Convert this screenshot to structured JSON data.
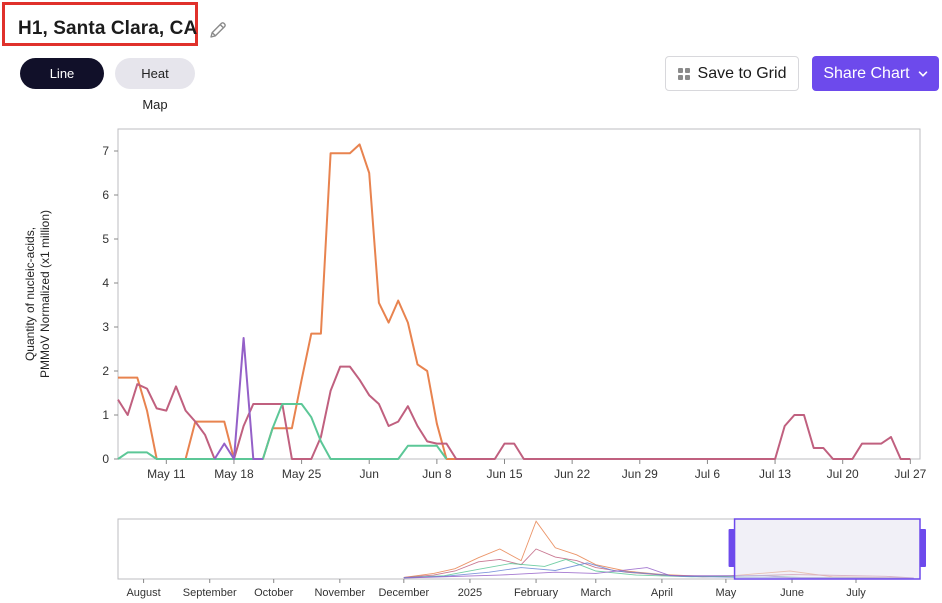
{
  "header": {
    "title": "H1, Santa Clara, CA",
    "tabs": [
      {
        "label": "Line Chart",
        "active": true
      },
      {
        "label": "Heat Map",
        "active": false
      }
    ],
    "save_label": "Save to Grid",
    "share_label": "Share Chart"
  },
  "colors": {
    "accent": "#6d4aec",
    "highlight_box": "#e0312b",
    "series_orange": "#e8834f",
    "series_mauve": "#c0607f",
    "series_green": "#5cc797",
    "series_purple": "#9460c8"
  },
  "chart_data": {
    "type": "line",
    "title": "",
    "xlabel": "",
    "ylabel_lines": [
      "Quantity of nucleic-acids,",
      "PMMoV Normalized (x1 million)"
    ],
    "x_start": "2025-05-06",
    "x_end": "2025-07-28",
    "ylim": [
      0,
      7.5
    ],
    "yticks": [
      0,
      1,
      2,
      3,
      4,
      5,
      6,
      7
    ],
    "xticks": [
      {
        "label": "May 11",
        "date": "2025-05-11"
      },
      {
        "label": "May 18",
        "date": "2025-05-18"
      },
      {
        "label": "May 25",
        "date": "2025-05-25"
      },
      {
        "label": "Jun",
        "date": "2025-06-01"
      },
      {
        "label": "Jun 8",
        "date": "2025-06-08"
      },
      {
        "label": "Jun 15",
        "date": "2025-06-15"
      },
      {
        "label": "Jun 22",
        "date": "2025-06-22"
      },
      {
        "label": "Jun 29",
        "date": "2025-06-29"
      },
      {
        "label": "Jul 6",
        "date": "2025-07-06"
      },
      {
        "label": "Jul 13",
        "date": "2025-07-13"
      },
      {
        "label": "Jul 20",
        "date": "2025-07-20"
      },
      {
        "label": "Jul 27",
        "date": "2025-07-27"
      }
    ],
    "grid": false,
    "series": [
      {
        "color": "#e8834f",
        "points": [
          [
            "2025-05-06",
            1.85
          ],
          [
            "2025-05-08",
            1.85
          ],
          [
            "2025-05-09",
            1.1
          ],
          [
            "2025-05-10",
            0
          ],
          [
            "2025-05-12",
            0
          ],
          [
            "2025-05-13",
            0
          ],
          [
            "2025-05-14",
            0.85
          ],
          [
            "2025-05-15",
            0.85
          ],
          [
            "2025-05-16",
            0.85
          ],
          [
            "2025-05-17",
            0.85
          ],
          [
            "2025-05-18",
            0
          ],
          [
            "2025-05-20",
            0
          ],
          [
            "2025-05-21",
            0
          ],
          [
            "2025-05-22",
            0.7
          ],
          [
            "2025-05-23",
            0.7
          ],
          [
            "2025-05-24",
            0.7
          ],
          [
            "2025-05-25",
            1.8
          ],
          [
            "2025-05-26",
            2.85
          ],
          [
            "2025-05-27",
            2.85
          ],
          [
            "2025-05-28",
            6.95
          ],
          [
            "2025-05-29",
            6.95
          ],
          [
            "2025-05-30",
            6.95
          ],
          [
            "2025-05-31",
            7.15
          ],
          [
            "2025-06-01",
            6.5
          ],
          [
            "2025-06-02",
            3.55
          ],
          [
            "2025-06-03",
            3.1
          ],
          [
            "2025-06-04",
            3.6
          ],
          [
            "2025-06-05",
            3.1
          ],
          [
            "2025-06-06",
            2.15
          ],
          [
            "2025-06-07",
            2.0
          ],
          [
            "2025-06-08",
            0.8
          ],
          [
            "2025-06-09",
            0
          ],
          [
            "2025-06-10",
            0
          ]
        ]
      },
      {
        "color": "#c0607f",
        "points": [
          [
            "2025-05-06",
            1.35
          ],
          [
            "2025-05-07",
            1.0
          ],
          [
            "2025-05-08",
            1.7
          ],
          [
            "2025-05-09",
            1.6
          ],
          [
            "2025-05-10",
            1.15
          ],
          [
            "2025-05-11",
            1.1
          ],
          [
            "2025-05-12",
            1.65
          ],
          [
            "2025-05-13",
            1.1
          ],
          [
            "2025-05-14",
            0.85
          ],
          [
            "2025-05-15",
            0.55
          ],
          [
            "2025-05-16",
            0
          ],
          [
            "2025-05-18",
            0
          ],
          [
            "2025-05-19",
            0.75
          ],
          [
            "2025-05-20",
            1.25
          ],
          [
            "2025-05-21",
            1.25
          ],
          [
            "2025-05-22",
            1.25
          ],
          [
            "2025-05-23",
            1.25
          ],
          [
            "2025-05-24",
            0
          ],
          [
            "2025-05-25",
            0
          ],
          [
            "2025-05-26",
            0
          ],
          [
            "2025-05-27",
            0.5
          ],
          [
            "2025-05-28",
            1.55
          ],
          [
            "2025-05-29",
            2.1
          ],
          [
            "2025-05-30",
            2.1
          ],
          [
            "2025-05-31",
            1.8
          ],
          [
            "2025-06-01",
            1.45
          ],
          [
            "2025-06-02",
            1.25
          ],
          [
            "2025-06-03",
            0.75
          ],
          [
            "2025-06-04",
            0.85
          ],
          [
            "2025-06-05",
            1.2
          ],
          [
            "2025-06-06",
            0.75
          ],
          [
            "2025-06-07",
            0.4
          ],
          [
            "2025-06-08",
            0.35
          ],
          [
            "2025-06-09",
            0.35
          ],
          [
            "2025-06-10",
            0
          ],
          [
            "2025-06-14",
            0
          ],
          [
            "2025-06-15",
            0.35
          ],
          [
            "2025-06-16",
            0.35
          ],
          [
            "2025-06-17",
            0
          ],
          [
            "2025-07-12",
            0
          ],
          [
            "2025-07-13",
            0
          ],
          [
            "2025-07-14",
            0.75
          ],
          [
            "2025-07-15",
            1.0
          ],
          [
            "2025-07-16",
            1.0
          ],
          [
            "2025-07-17",
            0.25
          ],
          [
            "2025-07-18",
            0.25
          ],
          [
            "2025-07-19",
            0
          ],
          [
            "2025-07-21",
            0
          ],
          [
            "2025-07-22",
            0.35
          ],
          [
            "2025-07-23",
            0.35
          ],
          [
            "2025-07-24",
            0.35
          ],
          [
            "2025-07-25",
            0.5
          ],
          [
            "2025-07-26",
            0
          ],
          [
            "2025-07-27",
            0
          ]
        ]
      },
      {
        "color": "#5cc797",
        "points": [
          [
            "2025-05-06",
            0
          ],
          [
            "2025-05-07",
            0.15
          ],
          [
            "2025-05-08",
            0.15
          ],
          [
            "2025-05-09",
            0.15
          ],
          [
            "2025-05-10",
            0
          ],
          [
            "2025-05-21",
            0
          ],
          [
            "2025-05-22",
            0.7
          ],
          [
            "2025-05-23",
            1.25
          ],
          [
            "2025-05-24",
            1.25
          ],
          [
            "2025-05-25",
            1.25
          ],
          [
            "2025-05-26",
            0.95
          ],
          [
            "2025-05-27",
            0.4
          ],
          [
            "2025-05-28",
            0
          ],
          [
            "2025-06-04",
            0
          ],
          [
            "2025-06-05",
            0.3
          ],
          [
            "2025-06-06",
            0.3
          ],
          [
            "2025-06-07",
            0.3
          ],
          [
            "2025-06-08",
            0.3
          ],
          [
            "2025-06-09",
            0
          ]
        ]
      },
      {
        "color": "#9460c8",
        "points": [
          [
            "2025-05-16",
            0
          ],
          [
            "2025-05-17",
            0.35
          ],
          [
            "2025-05-18",
            0
          ],
          [
            "2025-05-19",
            2.75
          ],
          [
            "2025-05-20",
            0
          ],
          [
            "2025-05-21",
            0
          ]
        ]
      }
    ]
  },
  "navigator": {
    "labels": [
      "August",
      "September",
      "October",
      "November",
      "December",
      "2025",
      "February",
      "March",
      "April",
      "May",
      "June",
      "July"
    ]
  }
}
